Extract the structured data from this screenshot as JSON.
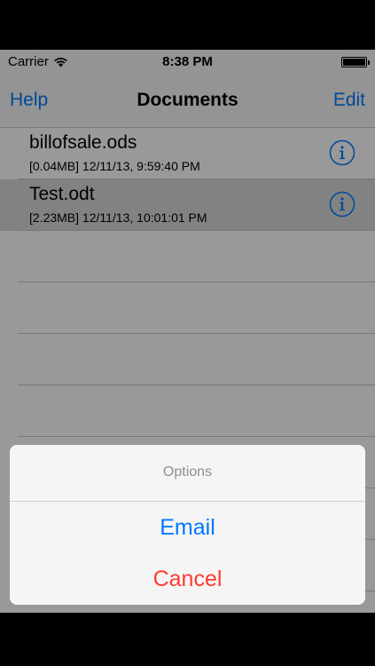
{
  "status_bar": {
    "carrier": "Carrier",
    "time": "8:38 PM",
    "wifi_icon": "wifi-icon",
    "battery_icon": "battery-icon"
  },
  "nav": {
    "left_label": "Help",
    "title": "Documents",
    "right_label": "Edit"
  },
  "documents": [
    {
      "name": "billofsale.ods",
      "meta": "[0.04MB] 12/11/13, 9:59:40 PM",
      "selected": false
    },
    {
      "name": "Test.odt",
      "meta": "[2.23MB] 12/11/13, 10:01:01 PM",
      "selected": true
    }
  ],
  "action_sheet": {
    "title": "Options",
    "email_label": "Email",
    "cancel_label": "Cancel"
  },
  "colors": {
    "accent": "#007aff",
    "destructive": "#ff3b30"
  }
}
